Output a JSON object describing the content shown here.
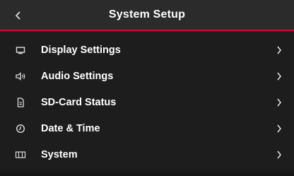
{
  "header": {
    "title": "System Setup",
    "back_icon": "chevron-left-icon",
    "accent_color": "#c8102e"
  },
  "menu": {
    "items": [
      {
        "label": "Display Settings",
        "icon": "display-icon"
      },
      {
        "label": "Audio Settings",
        "icon": "speaker-icon"
      },
      {
        "label": "SD-Card Status",
        "icon": "sd-card-icon"
      },
      {
        "label": "Date & Time",
        "icon": "clock-icon"
      },
      {
        "label": "System",
        "icon": "system-icon"
      }
    ],
    "chevron_icon": "chevron-right-icon"
  }
}
